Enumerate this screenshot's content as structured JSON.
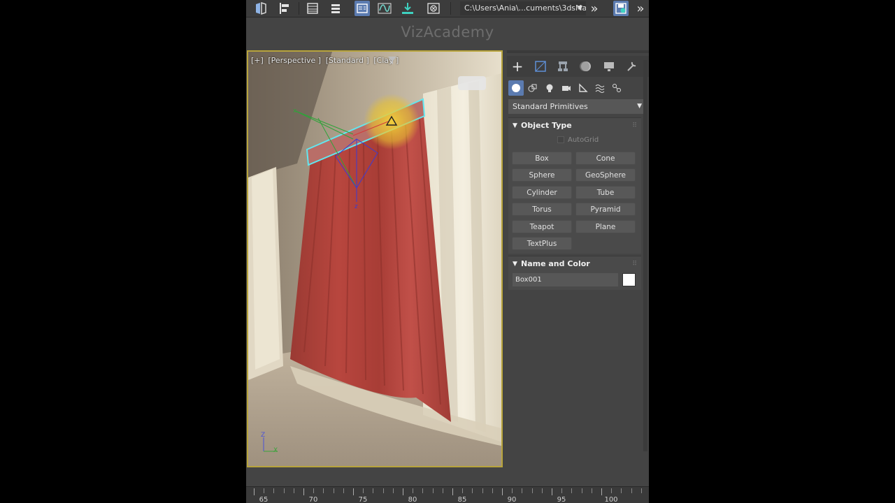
{
  "toolbar": {
    "icons": [
      "mirror-icon",
      "align-icon",
      "layer-manager-icon",
      "scene-explorer-icon",
      "toggle-ribbon-icon",
      "curve-editor-icon",
      "render-setup-icon",
      "material-editor-icon"
    ],
    "path": "C:\\Users\\Ania\\...cuments\\3dsMa",
    "more_glyph": "»"
  },
  "watermark": "VizAcademy",
  "viewport": {
    "labels": [
      "[+]",
      "[Perspective ]",
      "[Standard ]",
      "[Clay ]"
    ],
    "gizmo": {
      "z": "Z",
      "x": "X"
    }
  },
  "command_panel": {
    "tabs": [
      "create-tab",
      "modify-tab",
      "hierarchy-tab",
      "motion-tab",
      "display-tab",
      "utilities-tab"
    ],
    "categories": [
      "geometry",
      "shapes",
      "lights",
      "cameras",
      "helpers",
      "space-warps",
      "systems"
    ],
    "category_dropdown": "Standard Primitives",
    "object_type": {
      "title": "Object Type",
      "autogrid": "AutoGrid",
      "buttons": [
        "Box",
        "Cone",
        "Sphere",
        "GeoSphere",
        "Cylinder",
        "Tube",
        "Torus",
        "Pyramid",
        "Teapot",
        "Plane",
        "TextPlus"
      ]
    },
    "name_and_color": {
      "title": "Name and Color",
      "name_value": "Box001",
      "color": "#ffffff"
    }
  },
  "timeline": {
    "labels": [
      "65",
      "70",
      "75",
      "80",
      "85",
      "90",
      "95",
      "100"
    ]
  },
  "colors": {
    "viewport_border": "#b8a43c",
    "active_button": "#5b7bb0",
    "curtain": "#b3433c"
  }
}
